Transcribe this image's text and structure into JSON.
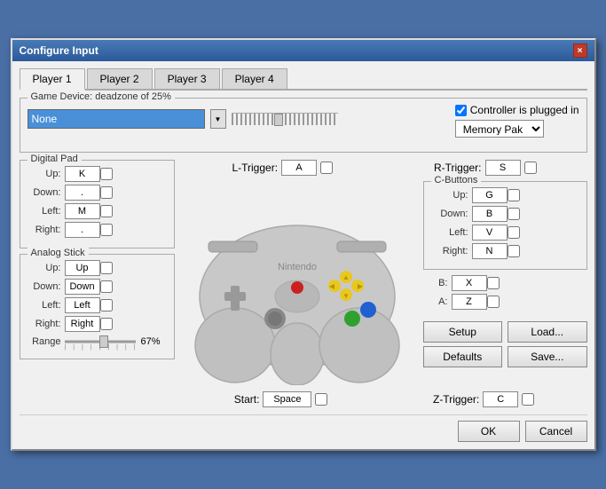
{
  "titleBar": {
    "title": "Configure Input",
    "closeIcon": "×"
  },
  "tabs": [
    {
      "id": "player1",
      "label": "Player 1",
      "active": true
    },
    {
      "id": "player2",
      "label": "Player 2",
      "active": false
    },
    {
      "id": "player3",
      "label": "Player 3",
      "active": false
    },
    {
      "id": "player4",
      "label": "Player 4",
      "active": false
    }
  ],
  "gameDevice": {
    "groupLabel": "Game Device: deadzone of 25%",
    "selectedValue": "None",
    "controllerPlugged": "Controller is plugged in",
    "memoryPakLabel": "Memory Pak"
  },
  "triggers": {
    "lTriggerLabel": "L-Trigger:",
    "lTriggerValue": "A",
    "rTriggerLabel": "R-Trigger:",
    "rTriggerValue": "S"
  },
  "digitalPad": {
    "groupLabel": "Digital Pad",
    "upLabel": "Up:",
    "upValue": "K",
    "downLabel": "Down:",
    "downValue": ".",
    "leftLabel": "Left:",
    "leftValue": "M",
    "rightLabel": "Right:",
    "rightValue": "."
  },
  "analogStick": {
    "groupLabel": "Analog Stick",
    "upLabel": "Up:",
    "upValue": "Up",
    "downLabel": "Down:",
    "downValue": "Down",
    "leftLabel": "Left:",
    "leftValue": "Left",
    "rightLabel": "Right:",
    "rightValue": "Right",
    "rangeLabel": "Range",
    "rangePercent": "67%"
  },
  "cButtons": {
    "groupLabel": "C-Buttons",
    "upLabel": "Up:",
    "upValue": "G",
    "downLabel": "Down:",
    "downValue": "B",
    "leftLabel": "Left:",
    "leftValue": "V",
    "rightLabel": "Right:",
    "rightValue": "N"
  },
  "bButton": {
    "label": "B:",
    "value": "X"
  },
  "aButton": {
    "label": "A:",
    "value": "Z"
  },
  "startRow": {
    "startLabel": "Start:",
    "startValue": "Space",
    "zTriggerLabel": "Z-Trigger:",
    "zTriggerValue": "C"
  },
  "actionButtons": {
    "setup": "Setup",
    "load": "Load...",
    "defaults": "Defaults",
    "save": "Save..."
  },
  "bottomButtons": {
    "ok": "OK",
    "cancel": "Cancel"
  }
}
